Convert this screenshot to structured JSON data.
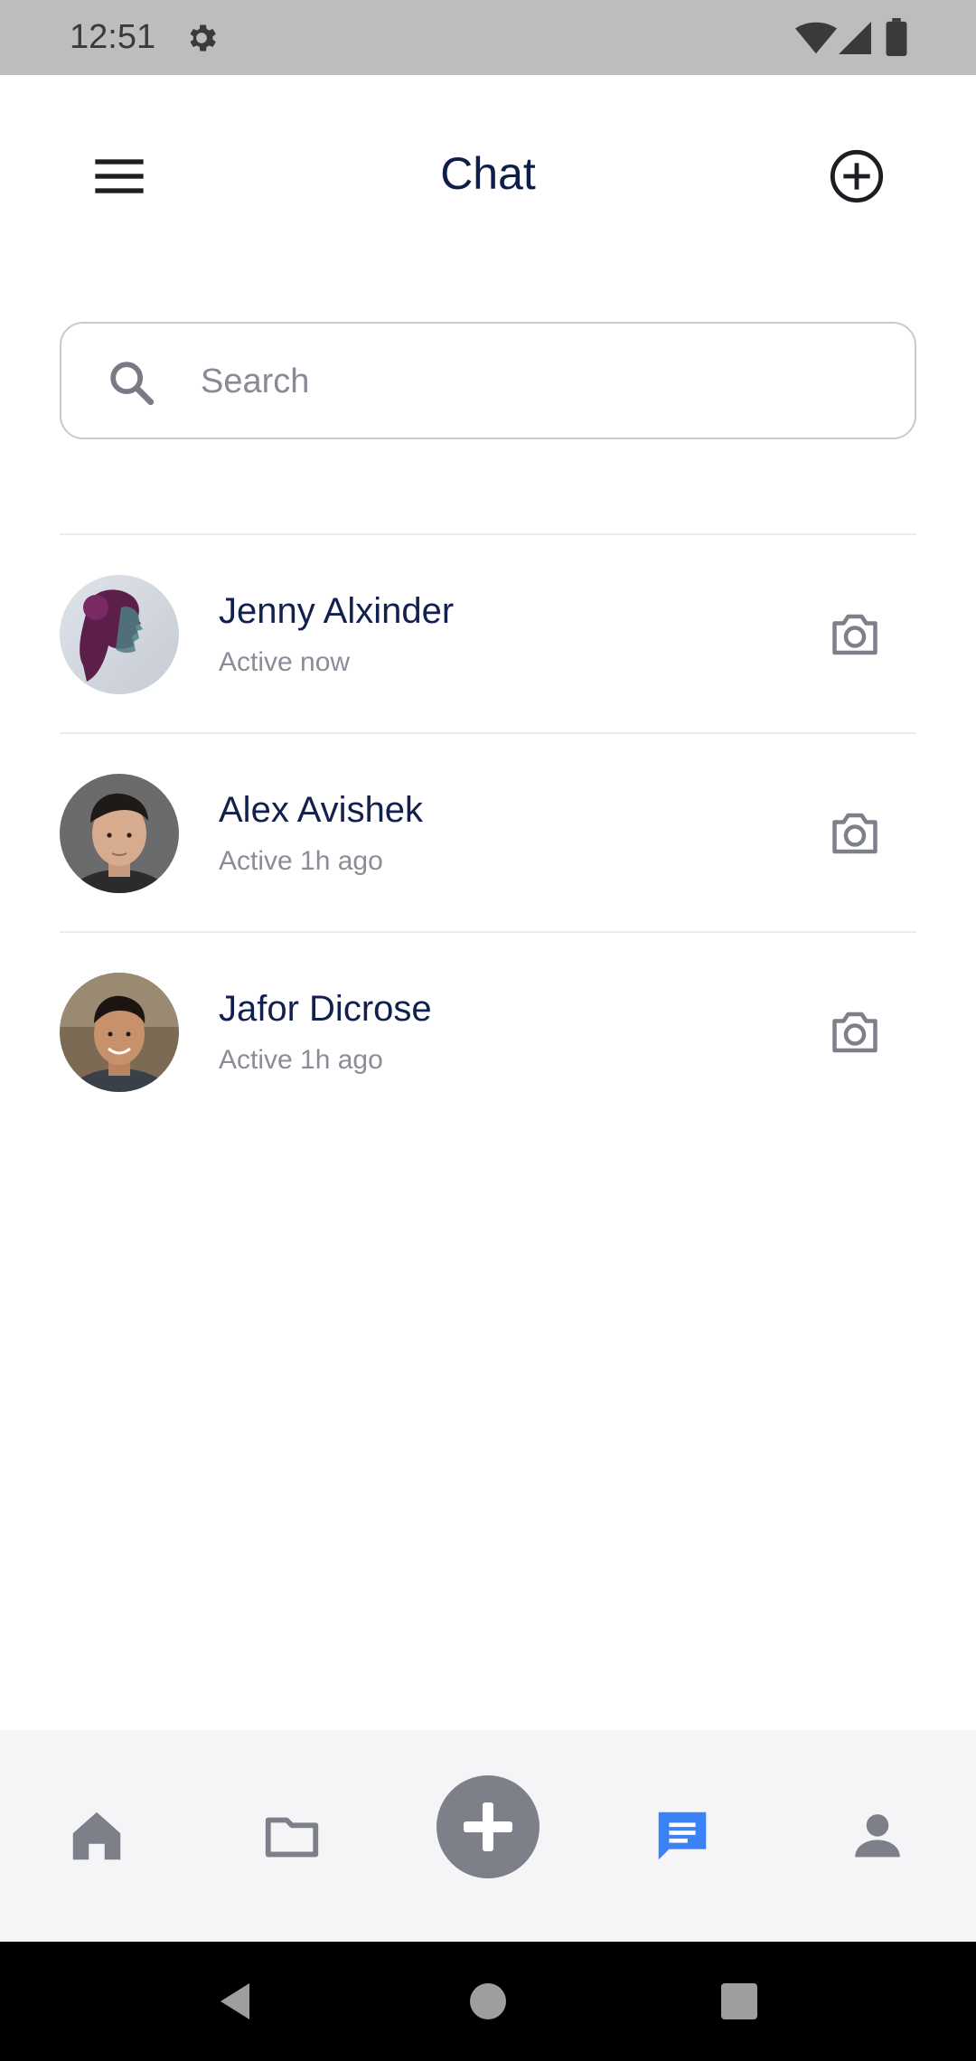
{
  "status_bar": {
    "time": "12:51"
  },
  "header": {
    "title": "Chat"
  },
  "search": {
    "placeholder": "Search"
  },
  "chats": [
    {
      "name": "Jenny Alxinder",
      "status": "Active now"
    },
    {
      "name": "Alex Avishek",
      "status": "Active 1h ago"
    },
    {
      "name": "Jafor Dicrose",
      "status": "Active 1h ago"
    }
  ],
  "bottom_nav": {
    "items": [
      "home-icon",
      "folder-icon",
      "add-icon",
      "chat-icon",
      "profile-icon"
    ],
    "active": "chat-icon",
    "active_color": "#3b82f6",
    "inactive_color": "#7d8089"
  },
  "colors": {
    "title": "#0f1d4a",
    "status_bar": "#bdbdbd"
  }
}
